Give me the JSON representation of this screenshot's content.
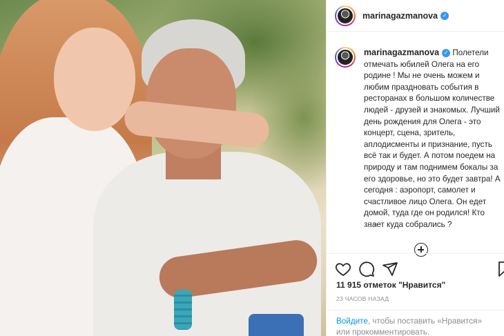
{
  "post": {
    "username": "marinagazmanova",
    "verified": true,
    "caption": "Полетели отмечать юбилей Олега на его родине ! Мы не очень можем и любим праздновать события в ресторанах в большом количестве людей - друзей и знакомых. Лучший день рождения для Олега - это концерт, сцена, зритель, аплодисменты и признание, пусть всё так и будет. А потом поедем на природу и там поднимем бокалы за его здоровье, но это будет завтра! А сегодня : аэропорт, самолет и счастливое лицо Олега. Он едет домой, туда где он родился! Кто знает куда собрались ?",
    "caption_time": "23 ч.",
    "likes_text": "11 915 отметок \"Нравится\"",
    "time_ago": "23 ЧАСОВ НАЗАД"
  },
  "login_prompt": {
    "link": "Войдите",
    "rest": ", чтобы поставить «Нравится» или прокомментировать."
  },
  "icons": {
    "like": "heart-icon",
    "comment": "comment-icon",
    "share": "share-icon",
    "save": "bookmark-icon",
    "load_more": "plus-circle-icon",
    "verified": "verified-badge-icon"
  },
  "colors": {
    "link": "#0095f6",
    "verified": "#3897f0",
    "muted": "#8e8e8e"
  }
}
